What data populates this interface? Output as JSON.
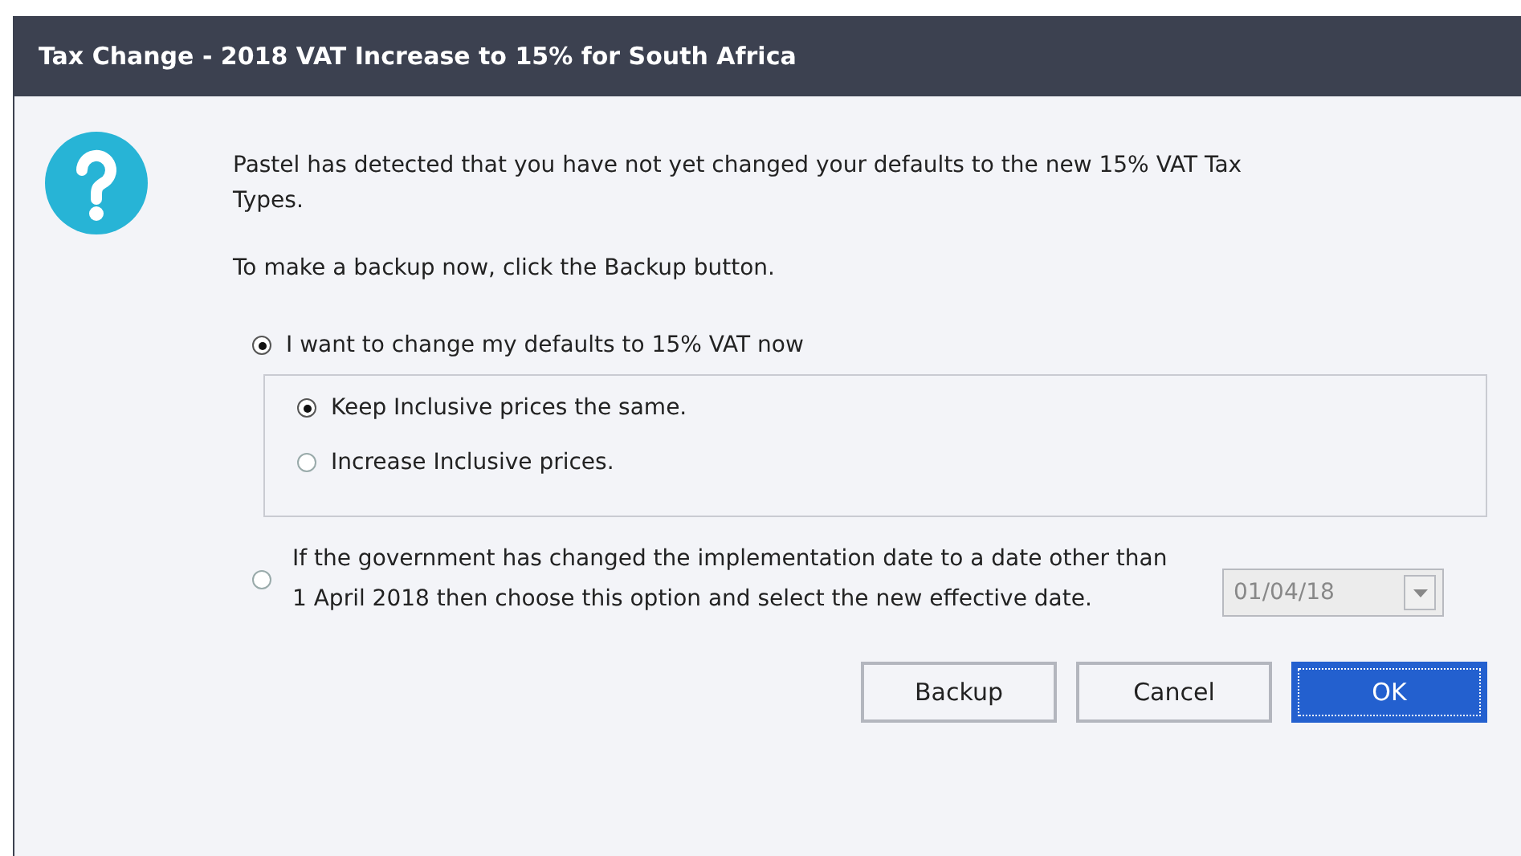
{
  "window": {
    "title": "Tax Change - 2018 VAT Increase to 15% for South Africa"
  },
  "message": [
    "Pastel has detected that you have not yet changed your defaults to the new 15% VAT Tax Types.",
    "To make a backup now, click the Backup button."
  ],
  "change_option": {
    "label": "I want to change my defaults to 15% VAT now",
    "selected": true,
    "sub_options": [
      {
        "label": "Keep Inclusive prices the same.",
        "selected": true
      },
      {
        "label": "Increase Inclusive prices.",
        "selected": false
      }
    ]
  },
  "date_option": {
    "label": "If the government has changed the implementation date to a date other than 1 April 2018 then choose this option and select the new effective date.",
    "selected": false,
    "date": "01/04/18",
    "disabled": true
  },
  "buttons": [
    {
      "label": "Backup",
      "default": false
    },
    {
      "label": "Cancel",
      "default": false
    },
    {
      "label": "OK",
      "default": true
    }
  ]
}
